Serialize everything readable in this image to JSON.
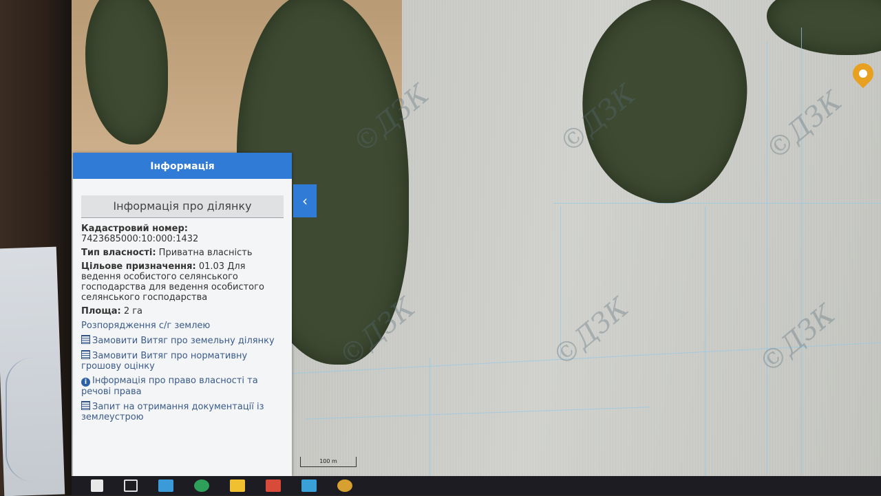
{
  "panel": {
    "title": "Інформація",
    "tab_label": "Інформація про ділянку",
    "collapse_icon": "chevron-left-icon",
    "cadastral_label": "Кадастровий номер:",
    "cadastral_value": "7423685000:10:000:1432",
    "ownership_label": "Тип власності:",
    "ownership_value": "Приватна власність",
    "purpose_label": "Цільове призначення:",
    "purpose_value": "01.03 Для ведення особистого селянського господарства для ведення особистого селянського господарства",
    "area_label": "Площа:",
    "area_value": "2 га",
    "disposal_text": "Розпорядження с/г землею",
    "links": [
      {
        "icon": "document-icon",
        "label": "Замовити Витяг про земельну ділянку"
      },
      {
        "icon": "document-icon",
        "label": "Замовити Витяг про нормативну грошову оцінку"
      },
      {
        "icon": "info-icon",
        "label": "Інформація про право власності та речові права"
      },
      {
        "icon": "document-icon",
        "label": "Запит на отримання документації із землеустрою"
      }
    ]
  },
  "map": {
    "watermark": "©ДЗК",
    "scale_label": "100 m",
    "marker_icon": "map-pin-icon",
    "marker_color": "#e8a020"
  },
  "taskbar": {
    "icons": [
      "windows-start-icon",
      "task-view-icon",
      "app-icon",
      "edge-browser-icon",
      "file-explorer-icon",
      "store-icon",
      "app-icon-2",
      "chrome-browser-icon"
    ]
  },
  "colors": {
    "header": "#2f7bd6",
    "panel_bg": "#f4f5f6"
  }
}
